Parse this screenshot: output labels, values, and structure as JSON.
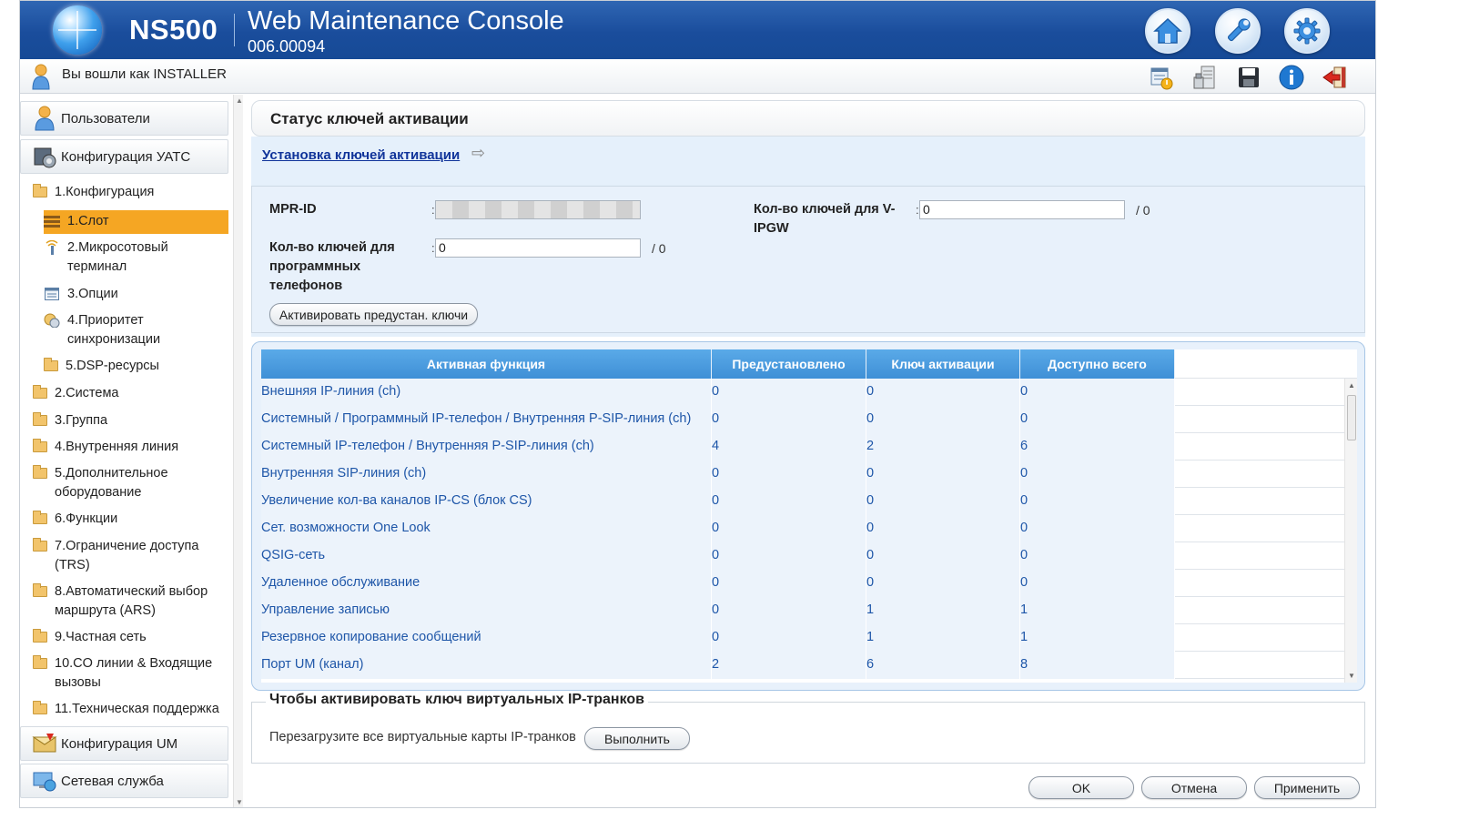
{
  "header": {
    "product": "NS500",
    "title": "Web Maintenance Console",
    "version": "006.00094",
    "buttons": [
      "home-icon",
      "wrench-icon",
      "gear-icon"
    ]
  },
  "userbar": {
    "logged_in_text": "Вы вошли как INSTALLER",
    "tools": [
      "report-icon",
      "phone-system-icon",
      "save-icon",
      "info-icon",
      "logout-icon"
    ]
  },
  "sidebar": {
    "categories": {
      "users": "Пользователи",
      "pbx_config": "Конфигурация УАТС",
      "um_config": "Конфигурация UM",
      "network": "Сетевая служба"
    },
    "config_folder": "1.Конфигурация",
    "config_children": [
      "1.Слот",
      "2.Микросотовый терминал",
      "3.Опции",
      "4.Приоритет синхронизации",
      "5.DSP-ресурсы"
    ],
    "folders": [
      "2.Система",
      "3.Группа",
      "4.Внутренняя линия",
      "5.Дополнительное оборудование",
      "6.Функции",
      "7.Ограничение доступа (TRS)",
      "8.Автоматический выбор маршрута (ARS)",
      "9.Частная сеть",
      "10.CO линии & Входящие вызовы",
      "11.Техническая поддержка"
    ],
    "selected_item": "1.Слот"
  },
  "main": {
    "page_title": "Статус ключей активации",
    "install_link": "Установка ключей активации",
    "mpr_id_label": "MPR-ID",
    "mpr_id_value": "",
    "vipgw_label": "Кол-во ключей для V-IPGW",
    "vipgw_value": "0",
    "vipgw_suffix": "/ 0",
    "softphone_label": "Кол-во ключей для программных телефонов",
    "softphone_value": "0",
    "softphone_suffix": "/ 0",
    "activate_preinstalled_button": "Активировать предустан. ключи",
    "table": {
      "headers": [
        "Активная функция",
        "Предустановлено",
        "Ключ активации",
        "Доступно всего"
      ],
      "rows": [
        [
          "Внешняя IP-линия (ch)",
          "0",
          "0",
          "0"
        ],
        [
          "Системный / Программный IP-телефон / Внутренняя P-SIP-линия (ch)",
          "0",
          "0",
          "0"
        ],
        [
          "Системный IP-телефон /  Внутренняя P-SIP-линия (ch)",
          "4",
          "2",
          "6"
        ],
        [
          "Внутренняя SIP-линия (ch)",
          "0",
          "0",
          "0"
        ],
        [
          "Увеличение кол-ва каналов IP-CS (блок CS)",
          "0",
          "0",
          "0"
        ],
        [
          "Сет. возможности One Look",
          "0",
          "0",
          "0"
        ],
        [
          "QSIG-сеть",
          "0",
          "0",
          "0"
        ],
        [
          "Удаленное обслуживание",
          "0",
          "0",
          "0"
        ],
        [
          "Управление записью",
          "0",
          "1",
          "1"
        ],
        [
          "Резервное копирование сообщений",
          "0",
          "1",
          "1"
        ],
        [
          "Порт UM (канал)",
          "2",
          "6",
          "8"
        ]
      ]
    },
    "virtual_trunk": {
      "legend": "Чтобы активировать ключ виртуальных IP-транков",
      "label": "Перезагрузите все виртуальные карты IP-транков",
      "execute_button": "Выполнить"
    },
    "footer": {
      "ok": "OK",
      "cancel": "Отмена",
      "apply": "Применить"
    }
  }
}
